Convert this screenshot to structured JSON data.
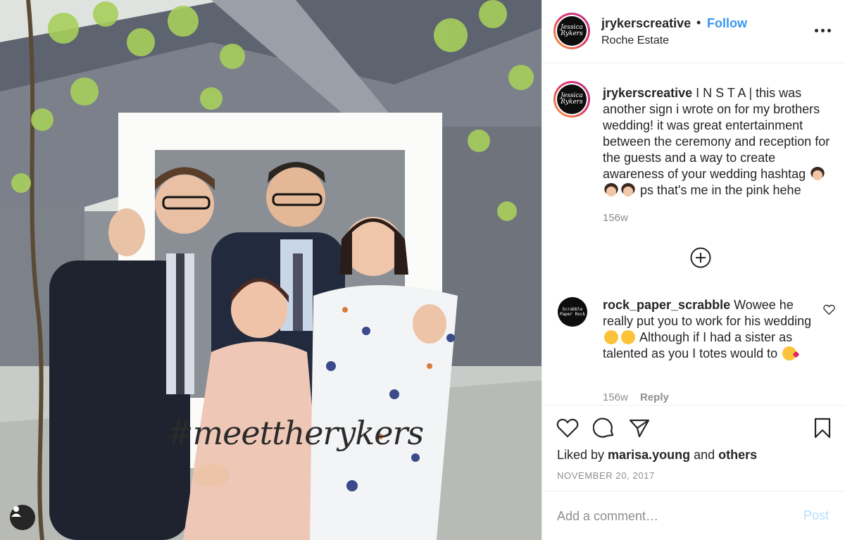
{
  "post": {
    "photo_frame_text": "#meettherykers",
    "user_tag_icon": "person-icon"
  },
  "header": {
    "avatar_text": "Jessica Rykers",
    "username": "jrykerscreative",
    "separator": "•",
    "follow_label": "Follow",
    "location": "Roche Estate",
    "more_icon": "more-options-icon"
  },
  "caption": {
    "username": "jrykerscreative",
    "text_part1": " I N S T A | this was another sign i wrote on for my brothers wedding! it was great entertainment between the ceremony and reception for the guests and a way to create awareness of your wedding hashtag ",
    "text_part2": " ps that's me in the pink hehe",
    "emoji": "woman-with-veil-emoji",
    "timestamp": "156w",
    "load_more_icon": "plus-circle-icon"
  },
  "comment": {
    "avatar_text": "Scrabble Paper Rock",
    "username": "rock_paper_scrabble",
    "text_part1": " Wowee he really put you to work for his wedding ",
    "text_part2": " Although if I had a sister as talented as you I totes would to ",
    "timestamp": "156w",
    "reply_label": "Reply",
    "like_icon": "heart-icon"
  },
  "actions": {
    "like_icon": "heart-icon",
    "comment_icon": "comment-icon",
    "share_icon": "share-icon",
    "save_icon": "bookmark-icon",
    "liked_prefix": "Liked by ",
    "liked_user": "marisa.young",
    "liked_and": " and ",
    "liked_others": "others",
    "date": "NOVEMBER 20, 2017"
  },
  "comment_box": {
    "placeholder": "Add a comment…",
    "post_label": "Post"
  },
  "colors": {
    "link_blue": "#3897f0",
    "muted": "#8e8e8e",
    "post_disabled": "#b2dffc"
  }
}
